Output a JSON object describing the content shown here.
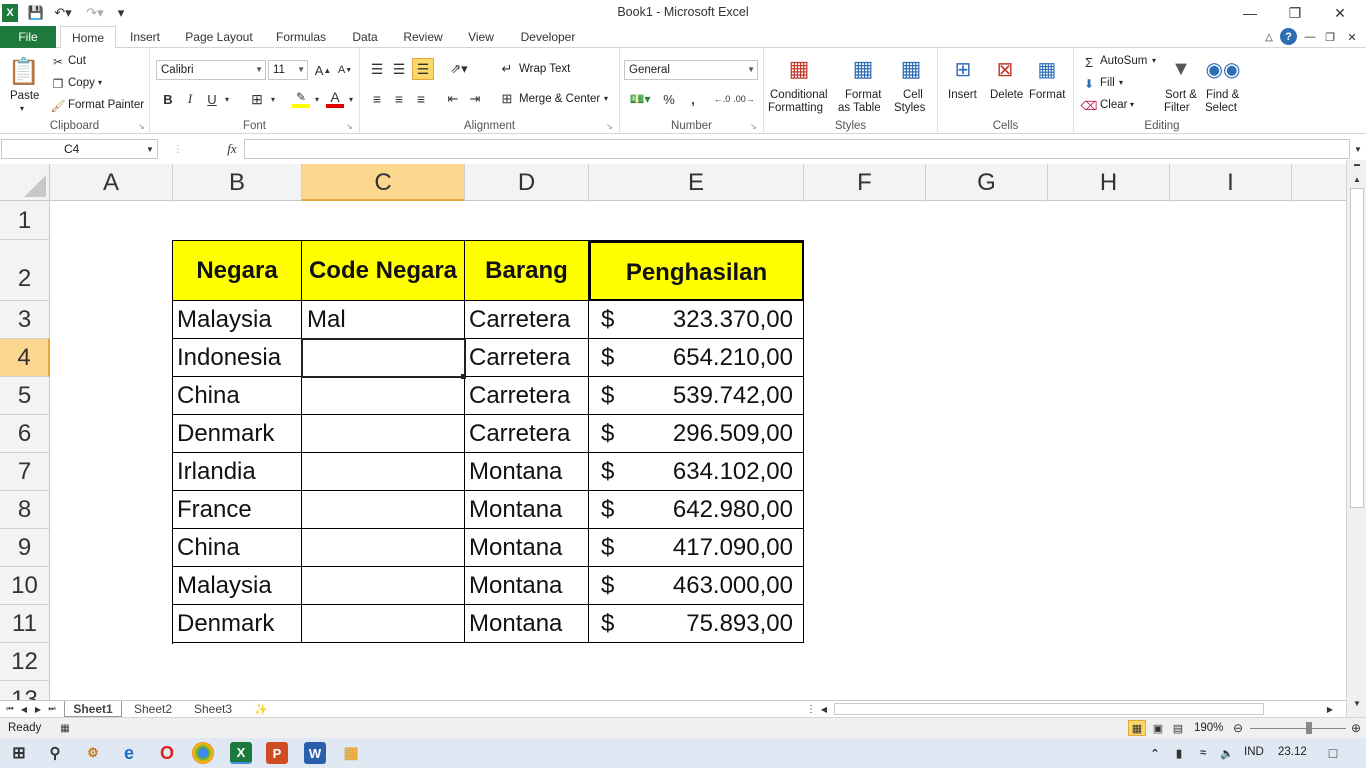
{
  "window": {
    "title": "Book1  -  Microsoft Excel"
  },
  "tabs": [
    "File",
    "Home",
    "Insert",
    "Page Layout",
    "Formulas",
    "Data",
    "Review",
    "View",
    "Developer"
  ],
  "ribbon": {
    "clipboard": {
      "label": "Clipboard",
      "paste": "Paste",
      "cut": "Cut",
      "copy": "Copy",
      "format_painter": "Format Painter"
    },
    "font": {
      "label": "Font",
      "font_name": "Calibri",
      "font_size": "11",
      "bold": "B",
      "italic": "I",
      "underline": "U"
    },
    "alignment": {
      "label": "Alignment",
      "wrap_text": "Wrap Text",
      "merge_center": "Merge & Center"
    },
    "number": {
      "label": "Number",
      "format": "General",
      "percent": "%",
      "comma": ","
    },
    "styles": {
      "label": "Styles",
      "conditional": "Conditional",
      "formatting": "Formatting",
      "format_as": "Format",
      "as_table": "as Table",
      "cell": "Cell",
      "cell_styles": "Styles"
    },
    "cells": {
      "label": "Cells",
      "insert": "Insert",
      "delete": "Delete",
      "format": "Format"
    },
    "editing": {
      "label": "Editing",
      "autosum": "AutoSum",
      "fill": "Fill",
      "clear": "Clear",
      "sort": "Sort &",
      "filter": "Filter",
      "find": "Find &",
      "select": "Select"
    }
  },
  "formula_bar": {
    "name_box": "C4",
    "fx": "fx",
    "value": ""
  },
  "columns": [
    "A",
    "B",
    "C",
    "D",
    "E",
    "F",
    "G",
    "H",
    "I"
  ],
  "rows": [
    "1",
    "2",
    "3",
    "4",
    "5",
    "6",
    "7",
    "8",
    "9",
    "10",
    "11",
    "12",
    "13"
  ],
  "table": {
    "headers": [
      "Negara",
      "Code Negara",
      "Barang",
      "Penghasilan"
    ],
    "currency": "$",
    "rows": [
      {
        "negara": "Malaysia",
        "code": "Mal",
        "barang": "Carretera",
        "value": "323.370,00"
      },
      {
        "negara": "Indonesia",
        "code": "",
        "barang": "Carretera",
        "value": "654.210,00"
      },
      {
        "negara": "China",
        "code": "",
        "barang": "Carretera",
        "value": "539.742,00"
      },
      {
        "negara": "Denmark",
        "code": "",
        "barang": "Carretera",
        "value": "296.509,00"
      },
      {
        "negara": "Irlandia",
        "code": "",
        "barang": "Montana",
        "value": "634.102,00"
      },
      {
        "negara": "France",
        "code": "",
        "barang": "Montana",
        "value": "642.980,00"
      },
      {
        "negara": "China",
        "code": "",
        "barang": "Montana",
        "value": "417.090,00"
      },
      {
        "negara": "Malaysia",
        "code": "",
        "barang": "Montana",
        "value": "463.000,00"
      },
      {
        "negara": "Denmark",
        "code": "",
        "barang": "Montana",
        "value": "75.893,00"
      }
    ]
  },
  "sheets": [
    "Sheet1",
    "Sheet2",
    "Sheet3"
  ],
  "status": {
    "ready": "Ready",
    "zoom": "190%"
  },
  "taskbar": {
    "lang": "IND",
    "time": "23.12"
  },
  "colors": {
    "excel_green": "#1e7a3c",
    "header_fill": "#ffff00",
    "selected_header": "#fbd790"
  }
}
